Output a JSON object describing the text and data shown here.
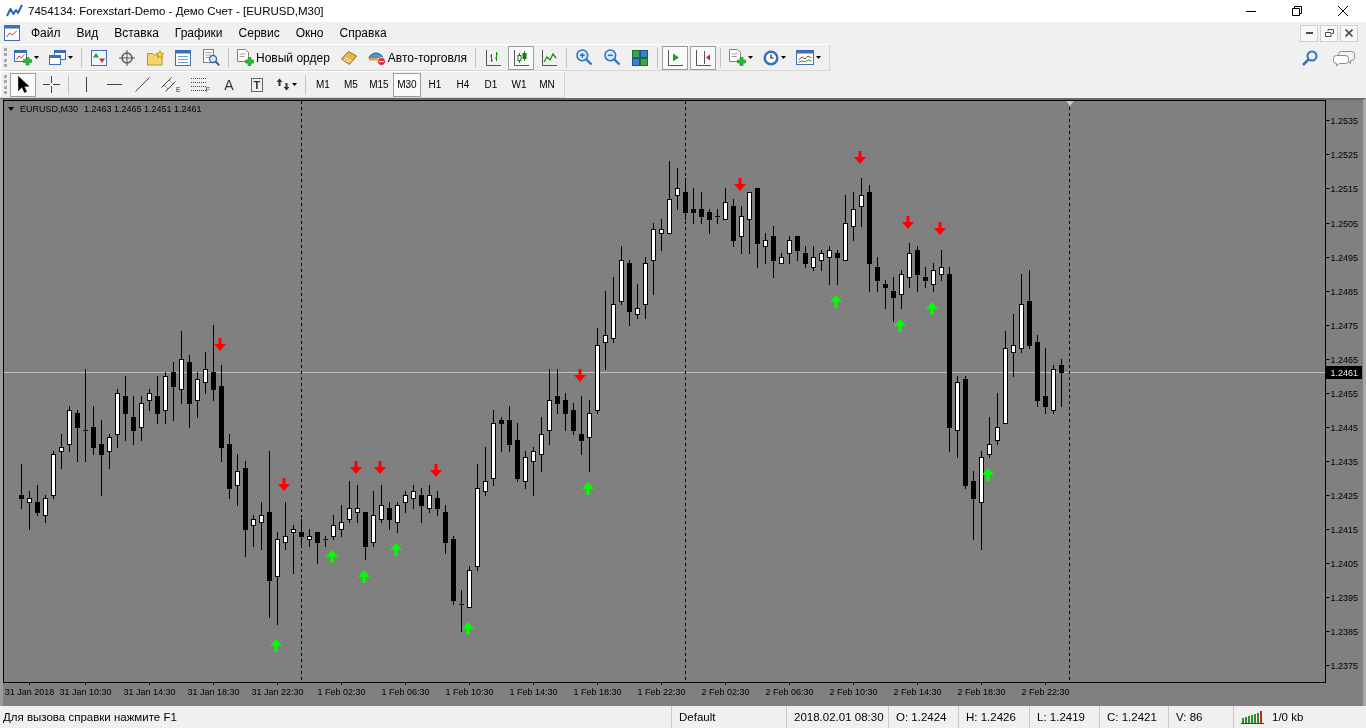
{
  "window": {
    "title": "7454134: Forexstart-Demo - Демо Счет - [EURUSD,M30]"
  },
  "menu": [
    "Файл",
    "Вид",
    "Вставка",
    "Графики",
    "Сервис",
    "Окно",
    "Справка"
  ],
  "toolbar": {
    "groups": [
      {
        "buttons": [
          {
            "kind": "new-chart",
            "dropdown": true,
            "pressed": false
          },
          {
            "kind": "profiles",
            "dropdown": true,
            "pressed": false
          }
        ]
      },
      {
        "buttons": [
          {
            "kind": "market-watch",
            "pressed": false
          },
          {
            "kind": "navigator",
            "pressed": false
          },
          {
            "kind": "data-folder",
            "pressed": false
          },
          {
            "kind": "terminal",
            "pressed": false
          },
          {
            "kind": "tester",
            "pressed": false
          }
        ]
      },
      {
        "buttons": [
          {
            "kind": "new-order",
            "label": "Новый ордер",
            "pressed": false
          },
          {
            "kind": "editor",
            "pressed": false
          },
          {
            "kind": "autotrading",
            "label": "Авто-торговля",
            "pressed": false
          }
        ]
      },
      {
        "buttons": [
          {
            "kind": "bar-chart",
            "pressed": false
          },
          {
            "kind": "candlesticks",
            "pressed": true
          },
          {
            "kind": "line-chart",
            "pressed": false
          }
        ]
      },
      {
        "buttons": [
          {
            "kind": "zoom-in",
            "pressed": false
          },
          {
            "kind": "zoom-out",
            "pressed": false
          },
          {
            "kind": "tile",
            "pressed": false
          }
        ]
      },
      {
        "buttons": [
          {
            "kind": "autoscroll",
            "pressed": true
          },
          {
            "kind": "chart-shift",
            "pressed": true
          }
        ]
      },
      {
        "buttons": [
          {
            "kind": "indicators",
            "dropdown": true,
            "pressed": false
          },
          {
            "kind": "periods",
            "dropdown": true,
            "pressed": false
          },
          {
            "kind": "templates",
            "dropdown": true,
            "pressed": false
          }
        ]
      }
    ]
  },
  "line_studies": {
    "groups": [
      {
        "tools": [
          {
            "kind": "cursor",
            "pressed": true
          },
          {
            "kind": "crosshair",
            "pressed": false
          }
        ]
      },
      {
        "tools": [
          {
            "kind": "vertical-line",
            "pressed": false
          },
          {
            "kind": "horizontal-line",
            "pressed": false
          },
          {
            "kind": "trendline",
            "pressed": false
          },
          {
            "kind": "channel",
            "sub": "E",
            "pressed": false
          },
          {
            "kind": "fibonacci",
            "sub": "F",
            "pressed": false
          },
          {
            "kind": "text",
            "label": "A",
            "pressed": false
          },
          {
            "kind": "text-label",
            "label": "T",
            "pressed": false
          },
          {
            "kind": "arrows",
            "dropdown": true,
            "pressed": false
          }
        ]
      }
    ]
  },
  "periods": [
    {
      "label": "M1",
      "selected": false
    },
    {
      "label": "M5",
      "selected": false
    },
    {
      "label": "M15",
      "selected": false
    },
    {
      "label": "M30",
      "selected": true
    },
    {
      "label": "H1",
      "selected": false
    },
    {
      "label": "H4",
      "selected": false
    },
    {
      "label": "D1",
      "selected": false
    },
    {
      "label": "W1",
      "selected": false
    },
    {
      "label": "MN",
      "selected": false
    }
  ],
  "chart": {
    "chart_data": [
      {
        "type": "candlestick",
        "title": "EURUSD,M30",
        "subtitle": "1.2463 1.2465 1.2451 1.2461",
        "xlim": [
          "2018-01-31T05:25",
          "2018-02-03T16:03"
        ],
        "ylim": [
          1.237,
          1.2541
        ],
        "xticks": [
          {
            "value": "2018-01-31T07:00",
            "label": "31 Jan 2018"
          },
          {
            "value": "2018-01-31T10:30",
            "label": "31 Jan 10:30"
          },
          {
            "value": "2018-01-31T14:30",
            "label": "31 Jan 14:30"
          },
          {
            "value": "2018-01-31T18:30",
            "label": "31 Jan 18:30"
          },
          {
            "value": "2018-01-31T22:30",
            "label": "31 Jan 22:30"
          },
          {
            "value": "2018-02-01T02:30",
            "label": "1 Feb 02:30"
          },
          {
            "value": "2018-02-01T06:30",
            "label": "1 Feb 06:30"
          },
          {
            "value": "2018-02-01T10:30",
            "label": "1 Feb 10:30"
          },
          {
            "value": "2018-02-01T14:30",
            "label": "1 Feb 14:30"
          },
          {
            "value": "2018-02-01T18:30",
            "label": "1 Feb 18:30"
          },
          {
            "value": "2018-02-01T22:30",
            "label": "1 Feb 22:30"
          },
          {
            "value": "2018-02-02T02:30",
            "label": "2 Feb 02:30"
          },
          {
            "value": "2018-02-02T06:30",
            "label": "2 Feb 06:30"
          },
          {
            "value": "2018-02-02T10:30",
            "label": "2 Feb 10:30"
          },
          {
            "value": "2018-02-02T14:30",
            "label": "2 Feb 14:30"
          },
          {
            "value": "2018-02-02T18:30",
            "label": "2 Feb 18:30"
          },
          {
            "value": "2018-02-02T22:30",
            "label": "2 Feb 22:30"
          }
        ],
        "yticks": [
          {
            "value": 1.2375,
            "label": "1.2375"
          },
          {
            "value": 1.2385,
            "label": "1.2385"
          },
          {
            "value": 1.2395,
            "label": "1.2395"
          },
          {
            "value": 1.2405,
            "label": "1.2405"
          },
          {
            "value": 1.2415,
            "label": "1.2415"
          },
          {
            "value": 1.2425,
            "label": "1.2425"
          },
          {
            "value": 1.2435,
            "label": "1.2435"
          },
          {
            "value": 1.2445,
            "label": "1.2445"
          },
          {
            "value": 1.2455,
            "label": "1.2455"
          },
          {
            "value": 1.2465,
            "label": "1.2465"
          },
          {
            "value": 1.2475,
            "label": "1.2475"
          },
          {
            "value": 1.2485,
            "label": "1.2485"
          },
          {
            "value": 1.2495,
            "label": "1.2495"
          },
          {
            "value": 1.2505,
            "label": "1.2505"
          },
          {
            "value": 1.2515,
            "label": "1.2515"
          },
          {
            "value": 1.2525,
            "label": "1.2525"
          },
          {
            "value": 1.2535,
            "label": "1.2535"
          }
        ],
        "ref_lines": [
          {
            "axis": "y",
            "value": 1.2461,
            "label": "1.2461",
            "color": "#c0c0c0"
          },
          {
            "axis": "x",
            "value": "2018-02-01T00:00",
            "color": "#000000",
            "line_style": "dashed"
          },
          {
            "axis": "x",
            "value": "2018-02-02T00:00",
            "color": "#000000",
            "line_style": "dashed"
          },
          {
            "axis": "x",
            "value": "2018-02-03T00:00",
            "color": "#000000",
            "line_style": "dashed"
          }
        ],
        "x": [
          "2018-01-31T06:30",
          "2018-01-31T07:00",
          "2018-01-31T07:30",
          "2018-01-31T08:00",
          "2018-01-31T08:30",
          "2018-01-31T09:00",
          "2018-01-31T09:30",
          "2018-01-31T10:00",
          "2018-01-31T10:30",
          "2018-01-31T11:00",
          "2018-01-31T11:30",
          "2018-01-31T12:00",
          "2018-01-31T12:30",
          "2018-01-31T13:00",
          "2018-01-31T13:30",
          "2018-01-31T14:00",
          "2018-01-31T14:30",
          "2018-01-31T15:00",
          "2018-01-31T15:30",
          "2018-01-31T16:00",
          "2018-01-31T16:30",
          "2018-01-31T17:00",
          "2018-01-31T17:30",
          "2018-01-31T18:00",
          "2018-01-31T18:30",
          "2018-01-31T19:00",
          "2018-01-31T19:30",
          "2018-01-31T20:00",
          "2018-01-31T20:30",
          "2018-01-31T21:00",
          "2018-01-31T21:30",
          "2018-01-31T22:00",
          "2018-01-31T22:30",
          "2018-01-31T23:00",
          "2018-01-31T23:30",
          "2018-02-01T00:00",
          "2018-02-01T00:30",
          "2018-02-01T01:00",
          "2018-02-01T01:30",
          "2018-02-01T02:00",
          "2018-02-01T02:30",
          "2018-02-01T03:00",
          "2018-02-01T03:30",
          "2018-02-01T04:00",
          "2018-02-01T04:30",
          "2018-02-01T05:00",
          "2018-02-01T05:30",
          "2018-02-01T06:00",
          "2018-02-01T06:30",
          "2018-02-01T07:00",
          "2018-02-01T07:30",
          "2018-02-01T08:00",
          "2018-02-01T08:30",
          "2018-02-01T09:00",
          "2018-02-01T09:30",
          "2018-02-01T10:00",
          "2018-02-01T10:30",
          "2018-02-01T11:00",
          "2018-02-01T11:30",
          "2018-02-01T12:00",
          "2018-02-01T12:30",
          "2018-02-01T13:00",
          "2018-02-01T13:30",
          "2018-02-01T14:00",
          "2018-02-01T14:30",
          "2018-02-01T15:00",
          "2018-02-01T15:30",
          "2018-02-01T16:00",
          "2018-02-01T16:30",
          "2018-02-01T17:00",
          "2018-02-01T17:30",
          "2018-02-01T18:00",
          "2018-02-01T18:30",
          "2018-02-01T19:00",
          "2018-02-01T19:30",
          "2018-02-01T20:00",
          "2018-02-01T20:30",
          "2018-02-01T21:00",
          "2018-02-01T21:30",
          "2018-02-01T22:00",
          "2018-02-01T22:30",
          "2018-02-01T23:00",
          "2018-02-01T23:30",
          "2018-02-02T00:00",
          "2018-02-02T00:30",
          "2018-02-02T01:00",
          "2018-02-02T01:30",
          "2018-02-02T02:00",
          "2018-02-02T02:30",
          "2018-02-02T03:00",
          "2018-02-02T03:30",
          "2018-02-02T04:00",
          "2018-02-02T04:30",
          "2018-02-02T05:00",
          "2018-02-02T05:30",
          "2018-02-02T06:00",
          "2018-02-02T06:30",
          "2018-02-02T07:00",
          "2018-02-02T07:30",
          "2018-02-02T08:00",
          "2018-02-02T08:30",
          "2018-02-02T09:00",
          "2018-02-02T09:30",
          "2018-02-02T10:00",
          "2018-02-02T10:30",
          "2018-02-02T11:00",
          "2018-02-02T11:30",
          "2018-02-02T12:00",
          "2018-02-02T12:30",
          "2018-02-02T13:00",
          "2018-02-02T13:30",
          "2018-02-02T14:00",
          "2018-02-02T14:30",
          "2018-02-02T15:00",
          "2018-02-02T15:30",
          "2018-02-02T16:00",
          "2018-02-02T16:30",
          "2018-02-02T17:00",
          "2018-02-02T17:30",
          "2018-02-02T18:00",
          "2018-02-02T18:30",
          "2018-02-02T19:00",
          "2018-02-02T19:30",
          "2018-02-02T20:00",
          "2018-02-02T20:30",
          "2018-02-02T21:00",
          "2018-02-02T21:30",
          "2018-02-02T22:00",
          "2018-02-02T22:30",
          "2018-02-02T23:00",
          "2018-02-02T23:30"
        ],
        "ohlc": [
          [
            1.2425,
            1.2434,
            1.2421,
            1.2424
          ],
          [
            1.2423,
            1.2426,
            1.2415,
            1.2424
          ],
          [
            1.2423,
            1.2428,
            1.2419,
            1.242
          ],
          [
            1.2419,
            1.2425,
            1.2417,
            1.2424
          ],
          [
            1.2425,
            1.2438,
            1.2424,
            1.2437
          ],
          [
            1.2438,
            1.2443,
            1.2433,
            1.2439
          ],
          [
            1.244,
            1.2451,
            1.2438,
            1.245
          ],
          [
            1.2449,
            1.245,
            1.2435,
            1.2445
          ],
          [
            1.2444,
            1.2462,
            1.2435,
            1.2444
          ],
          [
            1.2445,
            1.2451,
            1.2437,
            1.2439
          ],
          [
            1.244,
            1.2447,
            1.2425,
            1.2437
          ],
          [
            1.2438,
            1.2443,
            1.2433,
            1.2442
          ],
          [
            1.2443,
            1.2456,
            1.2439,
            1.2455
          ],
          [
            1.2454,
            1.246,
            1.2441,
            1.2449
          ],
          [
            1.2448,
            1.2454,
            1.244,
            1.2444
          ],
          [
            1.2445,
            1.2454,
            1.2441,
            1.2452
          ],
          [
            1.2453,
            1.2456,
            1.245,
            1.2455
          ],
          [
            1.2454,
            1.246,
            1.2446,
            1.2449
          ],
          [
            1.245,
            1.2461,
            1.2446,
            1.246
          ],
          [
            1.2461,
            1.2464,
            1.2447,
            1.2457
          ],
          [
            1.2456,
            1.2473,
            1.2452,
            1.2465
          ],
          [
            1.2464,
            1.2466,
            1.2445,
            1.2452
          ],
          [
            1.2453,
            1.2461,
            1.2448,
            1.2459
          ],
          [
            1.2458,
            1.2467,
            1.2455,
            1.2462
          ],
          [
            1.2461,
            1.2475,
            1.2453,
            1.2456
          ],
          [
            1.2457,
            1.2463,
            1.2435,
            1.2439
          ],
          [
            1.244,
            1.2443,
            1.2424,
            1.2427
          ],
          [
            1.2428,
            1.2437,
            1.2422,
            1.2432
          ],
          [
            1.2433,
            1.2435,
            1.2407,
            1.2415
          ],
          [
            1.2416,
            1.2419,
            1.241,
            1.2418
          ],
          [
            1.2417,
            1.2423,
            1.2409,
            1.2419
          ],
          [
            1.242,
            1.2438,
            1.2389,
            1.24
          ],
          [
            1.2401,
            1.2414,
            1.2387,
            1.2412
          ],
          [
            1.2411,
            1.2423,
            1.2409,
            1.2413
          ],
          [
            1.2414,
            1.2416,
            1.2402,
            1.2415
          ],
          [
            1.2414,
            1.2418,
            1.241,
            1.2413
          ],
          [
            1.2412,
            1.2415,
            1.241,
            1.2413
          ],
          [
            1.2414,
            1.2414,
            1.2405,
            1.2411
          ],
          [
            1.2412,
            1.2413,
            1.241,
            1.2412
          ],
          [
            1.2413,
            1.2419,
            1.2412,
            1.2416
          ],
          [
            1.2415,
            1.2422,
            1.2413,
            1.2417
          ],
          [
            1.2418,
            1.2429,
            1.2417,
            1.2421
          ],
          [
            1.242,
            1.2428,
            1.2417,
            1.2421
          ],
          [
            1.242,
            1.242,
            1.2406,
            1.241
          ],
          [
            1.2411,
            1.2426,
            1.241,
            1.2419
          ],
          [
            1.2418,
            1.2428,
            1.2417,
            1.2422
          ],
          [
            1.2421,
            1.2423,
            1.2415,
            1.2418
          ],
          [
            1.2417,
            1.2423,
            1.2414,
            1.2422
          ],
          [
            1.2423,
            1.2426,
            1.242,
            1.2425
          ],
          [
            1.2424,
            1.2428,
            1.2421,
            1.2426
          ],
          [
            1.2425,
            1.2427,
            1.2417,
            1.2422
          ],
          [
            1.2421,
            1.2428,
            1.242,
            1.2425
          ],
          [
            1.2424,
            1.2426,
            1.2419,
            1.2421
          ],
          [
            1.242,
            1.2422,
            1.2408,
            1.2411
          ],
          [
            1.2412,
            1.2413,
            1.2393,
            1.2394
          ],
          [
            1.2393,
            1.2397,
            1.2385,
            1.2393
          ],
          [
            1.2392,
            1.2404,
            1.2392,
            1.2403
          ],
          [
            1.2404,
            1.2434,
            1.2403,
            1.2427
          ],
          [
            1.2426,
            1.2439,
            1.2425,
            1.2429
          ],
          [
            1.243,
            1.245,
            1.2428,
            1.2446
          ],
          [
            1.2447,
            1.2448,
            1.2438,
            1.2446
          ],
          [
            1.2447,
            1.2451,
            1.2438,
            1.244
          ],
          [
            1.2441,
            1.2446,
            1.2429,
            1.243
          ],
          [
            1.2429,
            1.2438,
            1.2427,
            1.2436
          ],
          [
            1.2435,
            1.2439,
            1.2425,
            1.2438
          ],
          [
            1.2437,
            1.2448,
            1.2432,
            1.2443
          ],
          [
            1.2444,
            1.2462,
            1.244,
            1.2453
          ],
          [
            1.2454,
            1.2462,
            1.2449,
            1.2452
          ],
          [
            1.2453,
            1.2455,
            1.2444,
            1.2449
          ],
          [
            1.245,
            1.2452,
            1.2443,
            1.2444
          ],
          [
            1.2443,
            1.2454,
            1.2437,
            1.2441
          ],
          [
            1.2442,
            1.2453,
            1.2432,
            1.2449
          ],
          [
            1.245,
            1.2474,
            1.2449,
            1.2469
          ],
          [
            1.247,
            1.2485,
            1.2462,
            1.2472
          ],
          [
            1.2471,
            1.2489,
            1.247,
            1.2481
          ],
          [
            1.2482,
            1.2498,
            1.2481,
            1.2494
          ],
          [
            1.2493,
            1.2494,
            1.2475,
            1.2479
          ],
          [
            1.2478,
            1.2487,
            1.2477,
            1.248
          ],
          [
            1.2481,
            1.2495,
            1.2477,
            1.2493
          ],
          [
            1.2494,
            1.2505,
            1.2484,
            1.2503
          ],
          [
            1.2502,
            1.2506,
            1.2497,
            1.2503
          ],
          [
            1.2502,
            1.2523,
            1.2502,
            1.2512
          ],
          [
            1.2513,
            1.2521,
            1.2509,
            1.2515
          ],
          [
            1.2514,
            1.2518,
            1.2506,
            1.2508
          ],
          [
            1.2509,
            1.2515,
            1.2505,
            1.2508
          ],
          [
            1.2509,
            1.2514,
            1.2505,
            1.2507
          ],
          [
            1.2508,
            1.2509,
            1.2502,
            1.2506
          ],
          [
            1.2507,
            1.2509,
            1.2505,
            1.2507
          ],
          [
            1.2506,
            1.2515,
            1.2506,
            1.2511
          ],
          [
            1.251,
            1.2512,
            1.2498,
            1.25
          ],
          [
            1.2501,
            1.251,
            1.2496,
            1.2507
          ],
          [
            1.2506,
            1.2514,
            1.2496,
            1.2514
          ],
          [
            1.2515,
            1.2515,
            1.2492,
            1.2499
          ],
          [
            1.2498,
            1.2502,
            1.2493,
            1.25
          ],
          [
            1.2501,
            1.2504,
            1.2489,
            1.2494
          ],
          [
            1.2493,
            1.2496,
            1.2493,
            1.2495
          ],
          [
            1.2496,
            1.2501,
            1.2493,
            1.25
          ],
          [
            1.2501,
            1.2501,
            1.2494,
            1.2497
          ],
          [
            1.2496,
            1.2498,
            1.2492,
            1.2493
          ],
          [
            1.2492,
            1.2498,
            1.2491,
            1.2495
          ],
          [
            1.2494,
            1.2497,
            1.2491,
            1.2496
          ],
          [
            1.2495,
            1.2498,
            1.2487,
            1.2497
          ],
          [
            1.2496,
            1.2497,
            1.2487,
            1.2495
          ],
          [
            1.2494,
            1.2513,
            1.2494,
            1.2505
          ],
          [
            1.2504,
            1.2514,
            1.25,
            1.2509
          ],
          [
            1.251,
            1.2518,
            1.2504,
            1.2513
          ],
          [
            1.2514,
            1.2516,
            1.2485,
            1.2493
          ],
          [
            1.2492,
            1.2495,
            1.2485,
            1.2488
          ],
          [
            1.2487,
            1.2488,
            1.248,
            1.2486
          ],
          [
            1.2485,
            1.2489,
            1.2476,
            1.2483
          ],
          [
            1.2484,
            1.2491,
            1.248,
            1.249
          ],
          [
            1.2489,
            1.2499,
            1.2486,
            1.2496
          ],
          [
            1.2497,
            1.2498,
            1.2485,
            1.249
          ],
          [
            1.2489,
            1.2492,
            1.2486,
            1.2488
          ],
          [
            1.2487,
            1.2493,
            1.2485,
            1.2491
          ],
          [
            1.249,
            1.2497,
            1.2488,
            1.2492
          ],
          [
            1.249,
            1.2492,
            1.2438,
            1.2445
          ],
          [
            1.2444,
            1.246,
            1.2436,
            1.2458
          ],
          [
            1.2459,
            1.246,
            1.2427,
            1.2428
          ],
          [
            1.2429,
            1.2432,
            1.2412,
            1.2424
          ],
          [
            1.2423,
            1.2438,
            1.2409,
            1.2436
          ],
          [
            1.2437,
            1.2448,
            1.2436,
            1.244
          ],
          [
            1.2441,
            1.2455,
            1.244,
            1.2445
          ],
          [
            1.2446,
            1.2473,
            1.2446,
            1.2468
          ],
          [
            1.2467,
            1.2478,
            1.246,
            1.2469
          ],
          [
            1.2468,
            1.249,
            1.2467,
            1.2481
          ],
          [
            1.2482,
            1.2491,
            1.2468,
            1.2469
          ],
          [
            1.247,
            1.2472,
            1.2451,
            1.2453
          ],
          [
            1.2454,
            1.2468,
            1.2449,
            1.2451
          ],
          [
            1.245,
            1.2463,
            1.2449,
            1.2462
          ],
          [
            1.2463,
            1.2465,
            1.2451,
            1.2461
          ]
        ],
        "series": [
          {
            "type": "scatter",
            "color": "#ff0000",
            "x": [
              "2018-01-31T19:00",
              "2018-01-31T23:00",
              "2018-02-01T03:30",
              "2018-02-01T05:00",
              "2018-02-01T08:30",
              "2018-02-01T17:30",
              "2018-02-02T03:30",
              "2018-02-02T11:00",
              "2018-02-02T14:00",
              "2018-02-02T16:00"
            ],
            "values": [
              1.2469,
              1.2428,
              1.2433,
              1.2433,
              1.2432,
              1.246,
              1.2516,
              1.2524,
              1.2505,
              1.2503
            ]
          },
          {
            "type": "scatter",
            "color": "#00ff00",
            "x": [
              "2018-01-31T22:30",
              "2018-02-01T02:00",
              "2018-02-01T04:00",
              "2018-02-01T06:00",
              "2018-02-01T10:30",
              "2018-02-01T18:00",
              "2018-02-02T09:30",
              "2018-02-02T13:30",
              "2018-02-02T15:30",
              "2018-02-02T19:00"
            ],
            "values": [
              1.2381,
              1.2407,
              1.2401,
              1.2409,
              1.2386,
              1.2427,
              1.2482,
              1.2475,
              1.248,
              1.2431
            ]
          }
        ]
      }
    ]
  },
  "status_bar": {
    "help": "Для вызова справки нажмите F1",
    "profile": "Default",
    "bar_time": "2018.02.01 08:30",
    "open": "O: 1.2424",
    "high": "H: 1.2426",
    "low": "L: 1.2419",
    "close": "C: 1.2421",
    "volume": "V: 86",
    "traffic": "1/0 kb"
  }
}
